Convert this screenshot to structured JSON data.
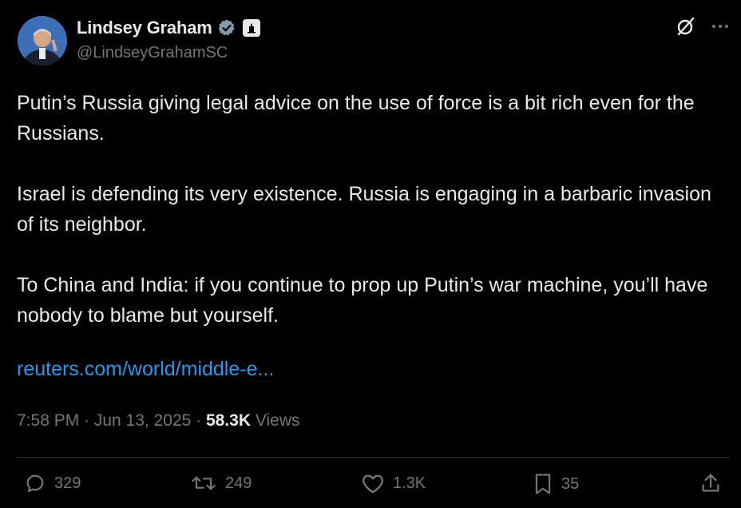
{
  "author": {
    "display_name": "Lindsey Graham",
    "handle": "@LindseyGrahamSC",
    "verified_icon": "verified-badge-icon",
    "affiliation_icon": "government-building-icon"
  },
  "tweet": {
    "paragraphs": [
      "Putin’s Russia giving legal advice on the use of force is a bit rich even for the Russians.",
      "Israel is defending its very existence. Russia is engaging in a barbaric invasion of its neighbor.",
      "To China and India: if you continue to prop up Putin’s war machine, you’ll have nobody to blame but yourself."
    ],
    "link_text": "reuters.com/world/middle-e..."
  },
  "meta": {
    "timestamp": "7:58 PM · Jun 13, 2025 · ",
    "views_count": "58.3K",
    "views_label": " Views"
  },
  "actions": {
    "replies": "329",
    "reposts": "249",
    "likes": "1.3K",
    "bookmarks": "35"
  },
  "colors": {
    "background": "#000000",
    "text": "#e7e9ea",
    "muted": "#71767b",
    "link": "#1d9bf0",
    "verified": "#829aab"
  }
}
